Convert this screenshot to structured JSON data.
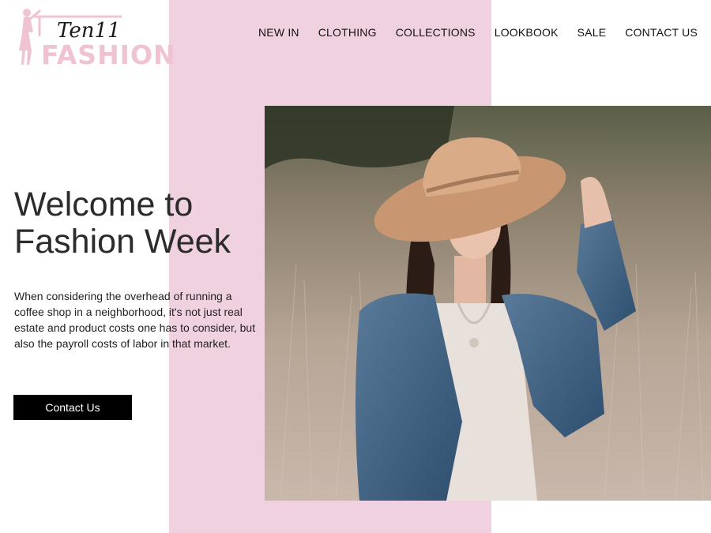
{
  "logo": {
    "script_text": "Ten11",
    "brand_text": "FASHION"
  },
  "nav": {
    "items": [
      "NEW IN",
      "CLOTHING",
      "COLLECTIONS",
      "LOOKBOOK",
      "SALE",
      "CONTACT US"
    ]
  },
  "hero": {
    "title": "Welcome to Fashion Week",
    "body": "When considering the overhead of running a coffee shop in a neighborhood, it's not just real estate and product costs one has to consider, but also the payroll costs of labor in that market.",
    "cta_label": "Contact Us"
  },
  "colors": {
    "accent_pink": "#f0d1df",
    "logo_pink": "#efc3d3",
    "button_bg": "#000000",
    "text_dark": "#2b2b2b"
  }
}
